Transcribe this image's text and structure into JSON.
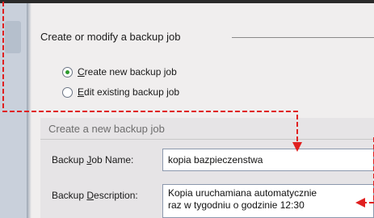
{
  "section": {
    "title": "Create or modify a backup job"
  },
  "options": [
    {
      "pre": "",
      "key": "C",
      "post": "reate new backup job",
      "checked": true
    },
    {
      "pre": "",
      "key": "E",
      "post": "dit existing backup job",
      "checked": false
    }
  ],
  "panel": {
    "title": "Create a new backup job",
    "name_label_pre": "Backup ",
    "name_label_key": "J",
    "name_label_post": "ob Name:",
    "name_value": "kopia bazpieczenstwa",
    "desc_label_pre": "Backup ",
    "desc_label_key": "D",
    "desc_label_post": "escription:",
    "desc_line1": "Kopia uruchamiana automatycznie",
    "desc_line2": "raz w tygodniu o godzinie 12:30"
  },
  "colors": {
    "annotation": "#e02020",
    "panel": "#e6e4e6",
    "input_border": "#8b98ad",
    "radio_dot": "#2c9a2c"
  }
}
